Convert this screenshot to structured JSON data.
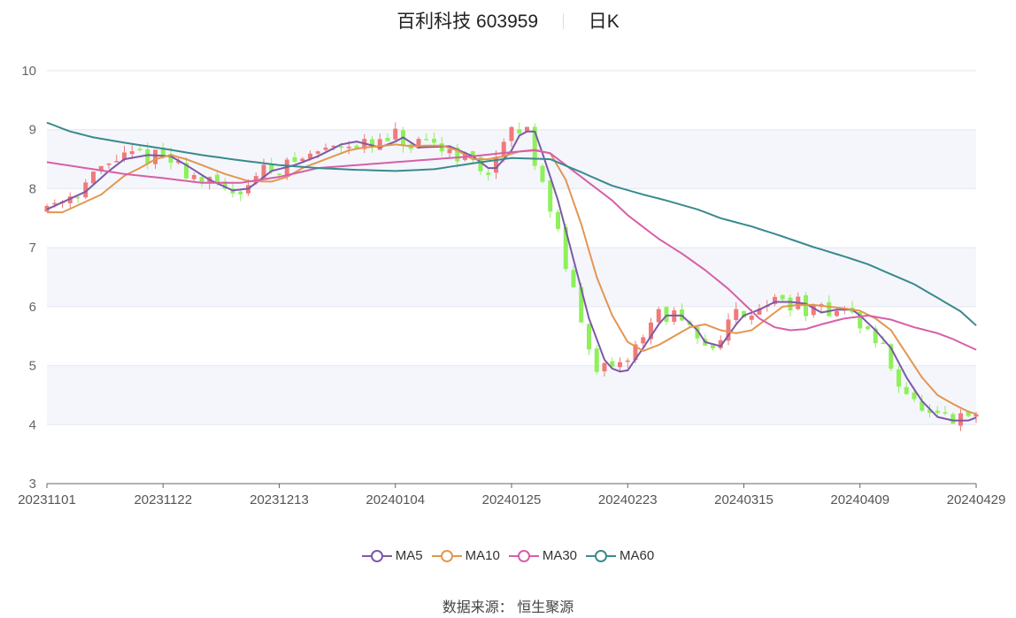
{
  "header": {
    "name": "百利科技",
    "code": "603959",
    "period": "日K"
  },
  "source": {
    "label": "数据来源：",
    "value": "恒生聚源"
  },
  "colors": {
    "up": "#f07a7a",
    "down": "#8ef05a",
    "ma5": "#7d58a8",
    "ma10": "#e39650",
    "ma30": "#d75fa8",
    "ma60": "#3a8a8c",
    "band": "#f4f6fb",
    "grid": "#e4e7ef"
  },
  "chart_data": {
    "type": "candlestick",
    "ylim": [
      3,
      10
    ],
    "y_ticks": [
      "3",
      "4",
      "5",
      "6",
      "7",
      "8",
      "9",
      "10"
    ],
    "x_tick_labels": [
      "20231101",
      "20231122",
      "20231213",
      "20240104",
      "20240125",
      "20240223",
      "20240315",
      "20240409",
      "20240429"
    ],
    "x_tick_index": [
      0,
      15,
      30,
      45,
      60,
      75,
      90,
      105,
      120
    ],
    "legend": [
      {
        "key": "ma5",
        "name": "MA5"
      },
      {
        "key": "ma10",
        "name": "MA10"
      },
      {
        "key": "ma30",
        "name": "MA30"
      },
      {
        "key": "ma60",
        "name": "MA60"
      }
    ],
    "ma5_anchors": [
      [
        0,
        7.65
      ],
      [
        5,
        7.95
      ],
      [
        8,
        8.3
      ],
      [
        10,
        8.5
      ],
      [
        13,
        8.57
      ],
      [
        16,
        8.55
      ],
      [
        18,
        8.4
      ],
      [
        21,
        8.15
      ],
      [
        24,
        7.97
      ],
      [
        26,
        8.0
      ],
      [
        29,
        8.3
      ],
      [
        32,
        8.4
      ],
      [
        35,
        8.55
      ],
      [
        38,
        8.75
      ],
      [
        40,
        8.8
      ],
      [
        43,
        8.7
      ],
      [
        45,
        8.8
      ],
      [
        46,
        8.87
      ],
      [
        48,
        8.7
      ],
      [
        52,
        8.72
      ],
      [
        55,
        8.55
      ],
      [
        57,
        8.35
      ],
      [
        58,
        8.35
      ],
      [
        60,
        8.65
      ],
      [
        61,
        8.9
      ],
      [
        62,
        8.97
      ],
      [
        63,
        8.97
      ],
      [
        64,
        8.6
      ],
      [
        66,
        7.8
      ],
      [
        68,
        6.8
      ],
      [
        70,
        5.8
      ],
      [
        72,
        5.1
      ],
      [
        73,
        4.95
      ],
      [
        74,
        4.9
      ],
      [
        75,
        4.92
      ],
      [
        77,
        5.3
      ],
      [
        79,
        5.7
      ],
      [
        80,
        5.85
      ],
      [
        82,
        5.85
      ],
      [
        84,
        5.6
      ],
      [
        85,
        5.4
      ],
      [
        87,
        5.33
      ],
      [
        89,
        5.7
      ],
      [
        90,
        5.85
      ],
      [
        92,
        5.95
      ],
      [
        94,
        6.08
      ],
      [
        96,
        6.08
      ],
      [
        98,
        6.05
      ],
      [
        100,
        5.9
      ],
      [
        102,
        5.95
      ],
      [
        104,
        5.95
      ],
      [
        105,
        5.85
      ],
      [
        107,
        5.6
      ],
      [
        109,
        5.3
      ],
      [
        111,
        4.8
      ],
      [
        113,
        4.4
      ],
      [
        115,
        4.13
      ],
      [
        117,
        4.07
      ],
      [
        119,
        4.07
      ],
      [
        120,
        4.12
      ]
    ],
    "ma10_anchors": [
      [
        0,
        7.6
      ],
      [
        2,
        7.6
      ],
      [
        4,
        7.72
      ],
      [
        7,
        7.9
      ],
      [
        10,
        8.22
      ],
      [
        12,
        8.35
      ],
      [
        14,
        8.5
      ],
      [
        16,
        8.57
      ],
      [
        18,
        8.5
      ],
      [
        20,
        8.4
      ],
      [
        23,
        8.25
      ],
      [
        26,
        8.13
      ],
      [
        29,
        8.12
      ],
      [
        31,
        8.2
      ],
      [
        33,
        8.35
      ],
      [
        35,
        8.45
      ],
      [
        37,
        8.55
      ],
      [
        39,
        8.65
      ],
      [
        41,
        8.7
      ],
      [
        43,
        8.72
      ],
      [
        45,
        8.75
      ],
      [
        47,
        8.72
      ],
      [
        49,
        8.73
      ],
      [
        51,
        8.73
      ],
      [
        53,
        8.65
      ],
      [
        55,
        8.5
      ],
      [
        57,
        8.5
      ],
      [
        59,
        8.55
      ],
      [
        61,
        8.63
      ],
      [
        63,
        8.66
      ],
      [
        65,
        8.6
      ],
      [
        67,
        8.15
      ],
      [
        69,
        7.4
      ],
      [
        71,
        6.5
      ],
      [
        73,
        5.85
      ],
      [
        75,
        5.4
      ],
      [
        77,
        5.25
      ],
      [
        79,
        5.35
      ],
      [
        81,
        5.5
      ],
      [
        83,
        5.65
      ],
      [
        85,
        5.7
      ],
      [
        87,
        5.6
      ],
      [
        89,
        5.55
      ],
      [
        91,
        5.6
      ],
      [
        93,
        5.8
      ],
      [
        95,
        6.0
      ],
      [
        97,
        6.03
      ],
      [
        99,
        6.03
      ],
      [
        101,
        6.0
      ],
      [
        103,
        5.97
      ],
      [
        105,
        5.93
      ],
      [
        107,
        5.8
      ],
      [
        109,
        5.6
      ],
      [
        111,
        5.2
      ],
      [
        113,
        4.8
      ],
      [
        115,
        4.5
      ],
      [
        117,
        4.35
      ],
      [
        119,
        4.22
      ],
      [
        120,
        4.18
      ]
    ],
    "ma30_anchors": [
      [
        0,
        8.45
      ],
      [
        5,
        8.35
      ],
      [
        10,
        8.25
      ],
      [
        15,
        8.18
      ],
      [
        20,
        8.1
      ],
      [
        25,
        8.1
      ],
      [
        30,
        8.2
      ],
      [
        35,
        8.35
      ],
      [
        40,
        8.4
      ],
      [
        45,
        8.45
      ],
      [
        50,
        8.5
      ],
      [
        55,
        8.55
      ],
      [
        60,
        8.62
      ],
      [
        63,
        8.65
      ],
      [
        65,
        8.6
      ],
      [
        67,
        8.4
      ],
      [
        70,
        8.1
      ],
      [
        73,
        7.8
      ],
      [
        75,
        7.55
      ],
      [
        77,
        7.35
      ],
      [
        79,
        7.15
      ],
      [
        82,
        6.9
      ],
      [
        85,
        6.62
      ],
      [
        88,
        6.3
      ],
      [
        90,
        6.05
      ],
      [
        92,
        5.8
      ],
      [
        94,
        5.65
      ],
      [
        96,
        5.6
      ],
      [
        98,
        5.62
      ],
      [
        100,
        5.7
      ],
      [
        103,
        5.8
      ],
      [
        106,
        5.85
      ],
      [
        109,
        5.78
      ],
      [
        112,
        5.65
      ],
      [
        115,
        5.55
      ],
      [
        117,
        5.45
      ],
      [
        120,
        5.27
      ]
    ],
    "ma60_anchors": [
      [
        0,
        9.12
      ],
      [
        3,
        8.97
      ],
      [
        6,
        8.87
      ],
      [
        10,
        8.78
      ],
      [
        15,
        8.68
      ],
      [
        20,
        8.57
      ],
      [
        25,
        8.48
      ],
      [
        30,
        8.4
      ],
      [
        35,
        8.35
      ],
      [
        40,
        8.32
      ],
      [
        45,
        8.3
      ],
      [
        50,
        8.33
      ],
      [
        55,
        8.43
      ],
      [
        60,
        8.52
      ],
      [
        65,
        8.5
      ],
      [
        69,
        8.28
      ],
      [
        73,
        8.05
      ],
      [
        77,
        7.9
      ],
      [
        80,
        7.8
      ],
      [
        84,
        7.65
      ],
      [
        87,
        7.5
      ],
      [
        91,
        7.36
      ],
      [
        95,
        7.19
      ],
      [
        99,
        7.01
      ],
      [
        103,
        6.85
      ],
      [
        106,
        6.72
      ],
      [
        109,
        6.55
      ],
      [
        112,
        6.38
      ],
      [
        115,
        6.15
      ],
      [
        118,
        5.92
      ],
      [
        120,
        5.68
      ]
    ]
  }
}
